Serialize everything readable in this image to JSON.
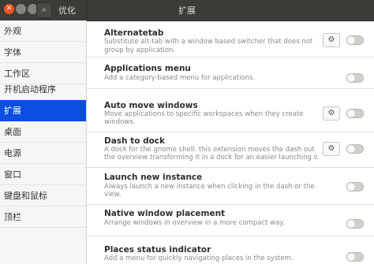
{
  "window": {
    "app_title": "优化",
    "section_title": "扩展",
    "close_glyph": "✕",
    "search_glyph": "⌕"
  },
  "sidebar": {
    "items": [
      {
        "label": "外观"
      },
      {
        "label": "字体"
      },
      {
        "label": "工作区"
      },
      {
        "label": "开机启动程序"
      },
      {
        "label": "扩展",
        "selected": true
      },
      {
        "label": "桌面"
      },
      {
        "label": "电源"
      },
      {
        "label": "窗口"
      },
      {
        "label": "键盘和鼠标"
      },
      {
        "label": "顶栏"
      }
    ]
  },
  "extensions": [
    {
      "name": "Alternatetab",
      "desc1": "Substitute alt-tab with a window based switcher that does not",
      "desc2": "group by application.",
      "has_settings": true,
      "enabled": false
    },
    {
      "name": "Applications menu",
      "desc1": "Add a category-based menu for applications.",
      "desc2": "",
      "has_settings": false,
      "enabled": false
    },
    {
      "name": "Auto move windows",
      "desc1": "Move applications to specific workspaces when they create",
      "desc2": "windows.",
      "has_settings": true,
      "enabled": false
    },
    {
      "name": "Dash to dock",
      "desc1": "A dock for the gnome shell. this extension moves the dash out of",
      "desc2": "the overview transforming it in a dock for an easier launching of ...",
      "has_settings": true,
      "enabled": false
    },
    {
      "name": "Launch new instance",
      "desc1": "Always launch a new instance when clicking in the dash or the application",
      "desc2": "view.",
      "has_settings": false,
      "enabled": false
    },
    {
      "name": "Native window placement",
      "desc1": "Arrange windows in overview in a more compact way.",
      "desc2": "",
      "has_settings": false,
      "enabled": false
    },
    {
      "name": "Places status indicator",
      "desc1": "Add a menu for quickly navigating places in the system.",
      "desc2": "",
      "has_settings": false,
      "enabled": false
    }
  ],
  "icons": {
    "gear_glyph": "⚙"
  },
  "colors": {
    "titlebar": "#3c3b37",
    "selected": "#0b4ee0",
    "close_button": "#e95420"
  }
}
